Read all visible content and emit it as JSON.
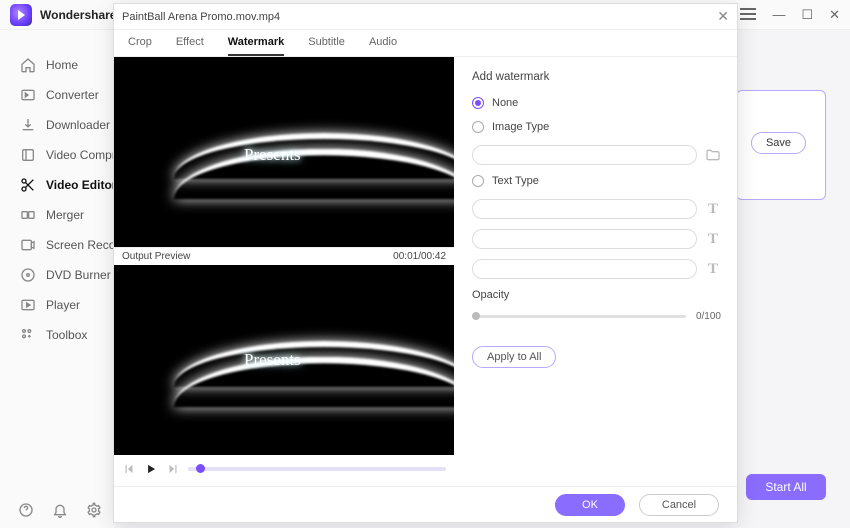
{
  "app": {
    "brand": "Wondershare |"
  },
  "window_controls": {
    "minimize": "—",
    "maximize": "☐",
    "close": "✕"
  },
  "sidebar": {
    "items": [
      {
        "label": "Home"
      },
      {
        "label": "Converter"
      },
      {
        "label": "Downloader"
      },
      {
        "label": "Video Compres"
      },
      {
        "label": "Video Editor"
      },
      {
        "label": "Merger"
      },
      {
        "label": "Screen Recorde"
      },
      {
        "label": "DVD Burner"
      },
      {
        "label": "Player"
      },
      {
        "label": "Toolbox"
      }
    ]
  },
  "background": {
    "save_label": "Save",
    "start_all_label": "Start All"
  },
  "modal": {
    "title": "PaintBall Arena Promo.mov.mp4",
    "tabs": [
      {
        "label": "Crop"
      },
      {
        "label": "Effect"
      },
      {
        "label": "Watermark"
      },
      {
        "label": "Subtitle"
      },
      {
        "label": "Audio"
      }
    ],
    "preview_text": "Presents",
    "output_preview_label": "Output Preview",
    "timecode": "00:01/00:42",
    "watermark": {
      "section_title": "Add watermark",
      "none_label": "None",
      "image_label": "Image Type",
      "text_label": "Text Type",
      "opacity_label": "Opacity",
      "opacity_value": "0/100",
      "apply_label": "Apply to All"
    },
    "ok_label": "OK",
    "cancel_label": "Cancel"
  }
}
